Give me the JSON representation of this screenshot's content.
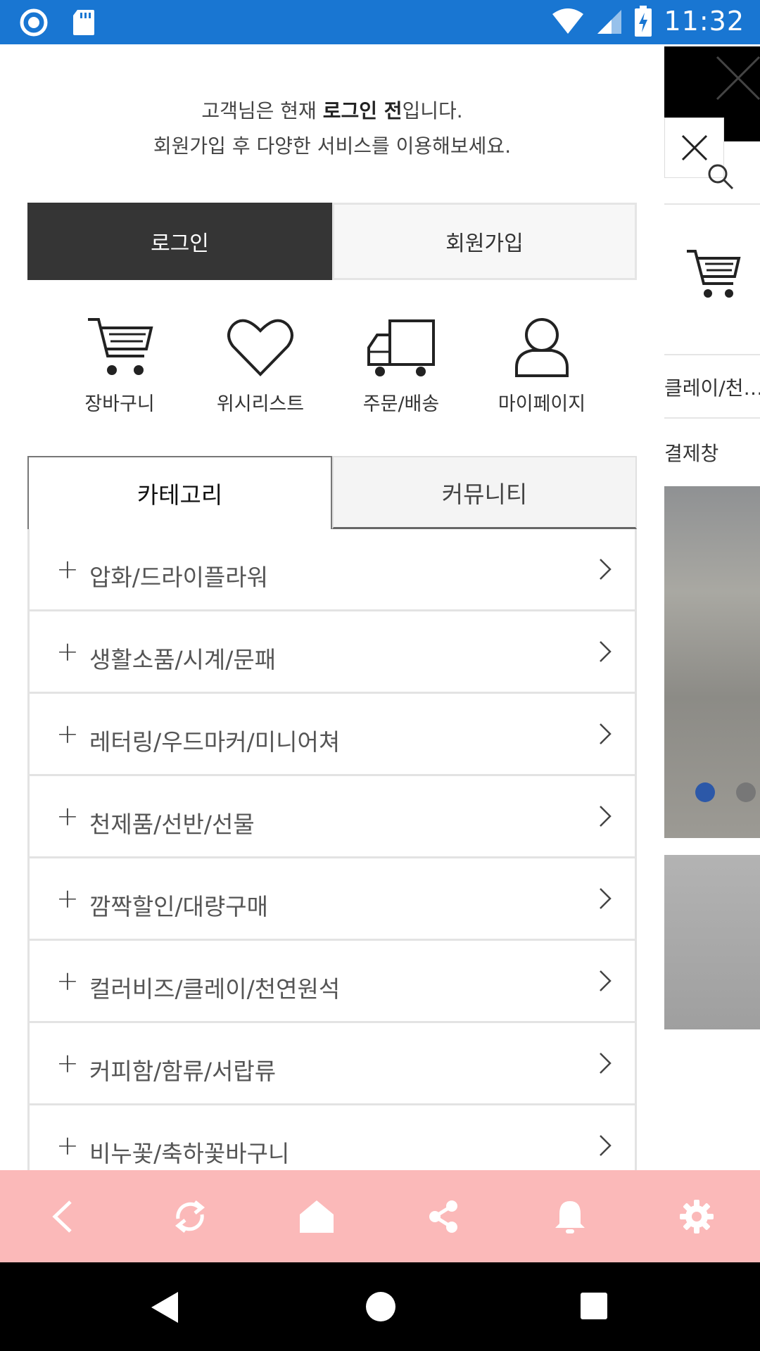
{
  "status_bar": {
    "time": "11:32"
  },
  "background_page": {
    "row1_text": "클레이/천…",
    "row2_text": "결제창"
  },
  "drawer": {
    "login_message": {
      "prefix": "고객님은 현재 ",
      "bold": "로그인 전",
      "suffix": "입니다.",
      "line2": "회원가입 후 다양한 서비스를 이용해보세요."
    },
    "login_button": "로그인",
    "join_button": "회원가입",
    "quick_links": [
      {
        "label": "장바구니",
        "icon": "cart-icon"
      },
      {
        "label": "위시리스트",
        "icon": "heart-icon"
      },
      {
        "label": "주문/배송",
        "icon": "truck-icon"
      },
      {
        "label": "마이페이지",
        "icon": "user-icon"
      }
    ],
    "tabs": [
      {
        "label": "카테고리",
        "active": true
      },
      {
        "label": "커뮤니티",
        "active": false
      }
    ],
    "categories": [
      "압화/드라이플라워",
      "생활소품/시계/문패",
      "레터링/우드마커/미니어쳐",
      "천제품/선반/선물",
      "깜짝할인/대량구매",
      "컬러비즈/클레이/천연원석",
      "커피함/함류/서랍류",
      "비누꽃/축하꽃바구니"
    ]
  },
  "app_bar": {
    "buttons": [
      "back-icon",
      "refresh-icon",
      "home-icon",
      "share-icon",
      "bell-icon",
      "gear-icon"
    ]
  },
  "colors": {
    "status_bar": "#1976d2",
    "app_bar": "#fbb9b9",
    "login_button": "#353535"
  }
}
